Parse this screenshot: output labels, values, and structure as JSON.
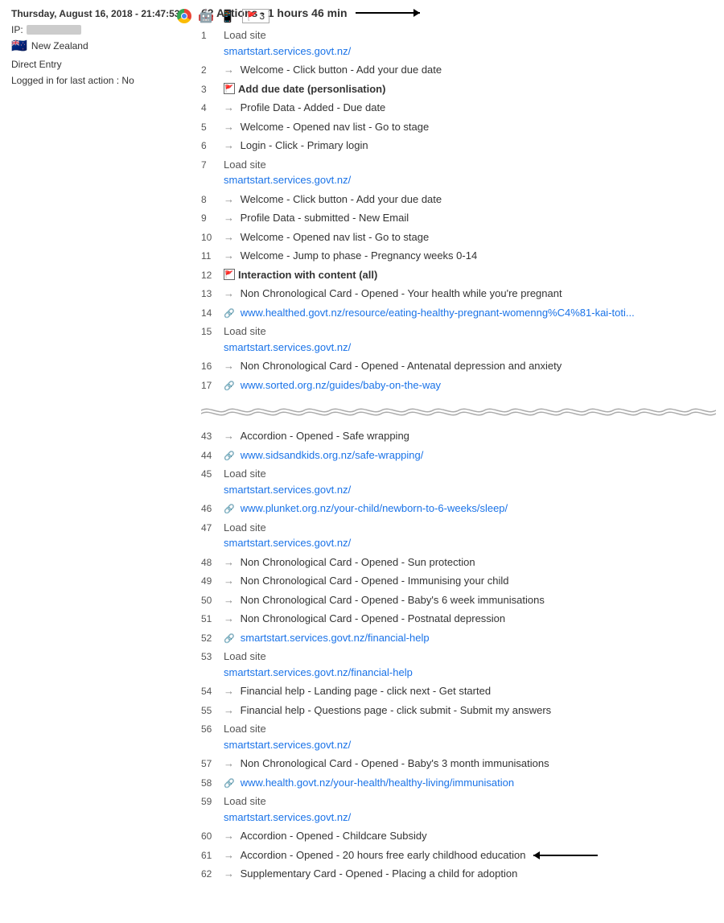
{
  "left": {
    "datetime": "Thursday, August 16, 2018 - 21:47:53",
    "ip_label": "IP:",
    "ip_value": "REDACTED",
    "country": "New Zealand",
    "entry_type": "Direct Entry",
    "logged_in": "Logged in for last action : No",
    "flag_num": "3"
  },
  "right": {
    "title": "62 Actions - 1 hours 46 min",
    "actions": [
      {
        "num": "1",
        "type": "load",
        "label": "Load site",
        "link": "smartstart.services.govt.nz/"
      },
      {
        "num": "2",
        "type": "arrow",
        "text": "Welcome - Click button - Add your due date"
      },
      {
        "num": "3",
        "type": "section",
        "text": "Add due date (personlisation)"
      },
      {
        "num": "4",
        "type": "arrow",
        "text": "Profile Data - Added - Due date"
      },
      {
        "num": "5",
        "type": "arrow",
        "text": "Welcome - Opened nav list - Go to stage"
      },
      {
        "num": "6",
        "type": "arrow",
        "text": "Login - Click - Primary login"
      },
      {
        "num": "7",
        "type": "load",
        "label": "Load site",
        "link": "smartstart.services.govt.nz/"
      },
      {
        "num": "8",
        "type": "arrow",
        "text": "Welcome - Click button - Add your due date"
      },
      {
        "num": "9",
        "type": "arrow",
        "text": "Profile Data - submitted - New Email"
      },
      {
        "num": "10",
        "type": "arrow",
        "text": "Welcome - Opened nav list - Go to stage"
      },
      {
        "num": "11",
        "type": "arrow",
        "text": "Welcome - Jump to phase - Pregnancy weeks 0-14"
      },
      {
        "num": "12",
        "type": "section",
        "text": "Interaction with content (all)"
      },
      {
        "num": "13",
        "type": "arrow",
        "text": "Non Chronological Card - Opened - Your health while you're pregnant"
      },
      {
        "num": "14",
        "type": "extlink",
        "link": "www.healthed.govt.nz/resource/eating-healthy-pregnant-womenng%C4%81-kai-toti..."
      },
      {
        "num": "15",
        "type": "load",
        "label": "Load site",
        "link": "smartstart.services.govt.nz/"
      },
      {
        "num": "16",
        "type": "arrow",
        "text": "Non Chronological Card - Opened - Antenatal depression and anxiety"
      },
      {
        "num": "17",
        "type": "extlink",
        "link": "www.sorted.org.nz/guides/baby-on-the-way"
      }
    ],
    "actions_lower": [
      {
        "num": "43",
        "type": "arrow",
        "text": "Accordion - Opened - Safe wrapping"
      },
      {
        "num": "44",
        "type": "extlink",
        "link": "www.sidsandkids.org.nz/safe-wrapping/"
      },
      {
        "num": "45",
        "type": "load",
        "label": "Load site",
        "link": "smartstart.services.govt.nz/"
      },
      {
        "num": "46",
        "type": "extlink",
        "link": "www.plunket.org.nz/your-child/newborn-to-6-weeks/sleep/"
      },
      {
        "num": "47",
        "type": "load",
        "label": "Load site",
        "link": "smartstart.services.govt.nz/"
      },
      {
        "num": "48",
        "type": "arrow",
        "text": "Non Chronological Card - Opened - Sun protection"
      },
      {
        "num": "49",
        "type": "arrow",
        "text": "Non Chronological Card - Opened - Immunising your child"
      },
      {
        "num": "50",
        "type": "arrow",
        "text": "Non Chronological Card - Opened - Baby's 6 week immunisations"
      },
      {
        "num": "51",
        "type": "arrow",
        "text": "Non Chronological Card - Opened - Postnatal depression"
      },
      {
        "num": "52",
        "type": "extlink",
        "link": "smartstart.services.govt.nz/financial-help"
      },
      {
        "num": "53",
        "type": "load",
        "label": "Load site",
        "link": "smartstart.services.govt.nz/financial-help"
      },
      {
        "num": "54",
        "type": "arrow",
        "text": "Financial help - Landing page - click next - Get started"
      },
      {
        "num": "55",
        "type": "arrow",
        "text": "Financial help - Questions page - click submit - Submit my answers"
      },
      {
        "num": "56",
        "type": "load",
        "label": "Load site",
        "link": "smartstart.services.govt.nz/"
      },
      {
        "num": "57",
        "type": "arrow",
        "text": "Non Chronological Card - Opened - Baby's 3 month immunisations"
      },
      {
        "num": "58",
        "type": "extlink",
        "link": "www.health.govt.nz/your-health/healthy-living/immunisation"
      },
      {
        "num": "59",
        "type": "load",
        "label": "Load site",
        "link": "smartstart.services.govt.nz/"
      },
      {
        "num": "60",
        "type": "arrow",
        "text": "Accordion - Opened - Childcare Subsidy"
      },
      {
        "num": "61",
        "type": "arrow",
        "text": "Accordion - Opened - 20 hours free early childhood education",
        "annotate_left": true
      },
      {
        "num": "62",
        "type": "arrow",
        "text": "Supplementary Card - Opened - Placing a child for adoption"
      }
    ]
  }
}
